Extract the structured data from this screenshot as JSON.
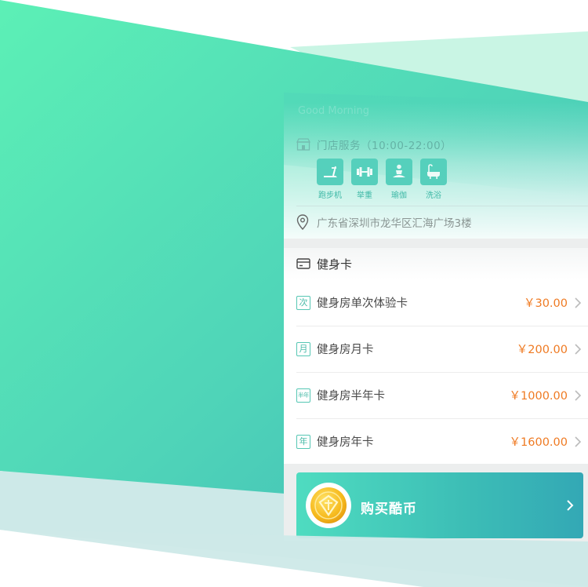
{
  "store": {
    "header_faded": "Good Morning",
    "service_label": "门店服务（10:00-22:00）",
    "facilities": [
      {
        "label": "跑步机",
        "icon": "treadmill-icon"
      },
      {
        "label": "举重",
        "icon": "dumbbell-icon"
      },
      {
        "label": "瑜伽",
        "icon": "yoga-icon"
      },
      {
        "label": "洗浴",
        "icon": "bathtub-icon"
      }
    ],
    "address": "广东省深圳市龙华区汇海广场3楼"
  },
  "cards": {
    "title": "健身卡",
    "items": [
      {
        "badge": "次",
        "name": "健身房单次体验卡",
        "price": "￥30.00"
      },
      {
        "badge": "月",
        "name": "健身房月卡",
        "price": "￥200.00"
      },
      {
        "badge": "半年",
        "name": "健身房半年卡",
        "price": "￥1000.00"
      },
      {
        "badge": "年",
        "name": "健身房年卡",
        "price": "￥1600.00"
      }
    ]
  },
  "buy": {
    "label": "购买酷币"
  },
  "colors": {
    "brand_green": "#56cfbc",
    "price_orange": "#ef7a22",
    "gradient_start": "#5aecb4",
    "gradient_end": "#42bdb5"
  }
}
